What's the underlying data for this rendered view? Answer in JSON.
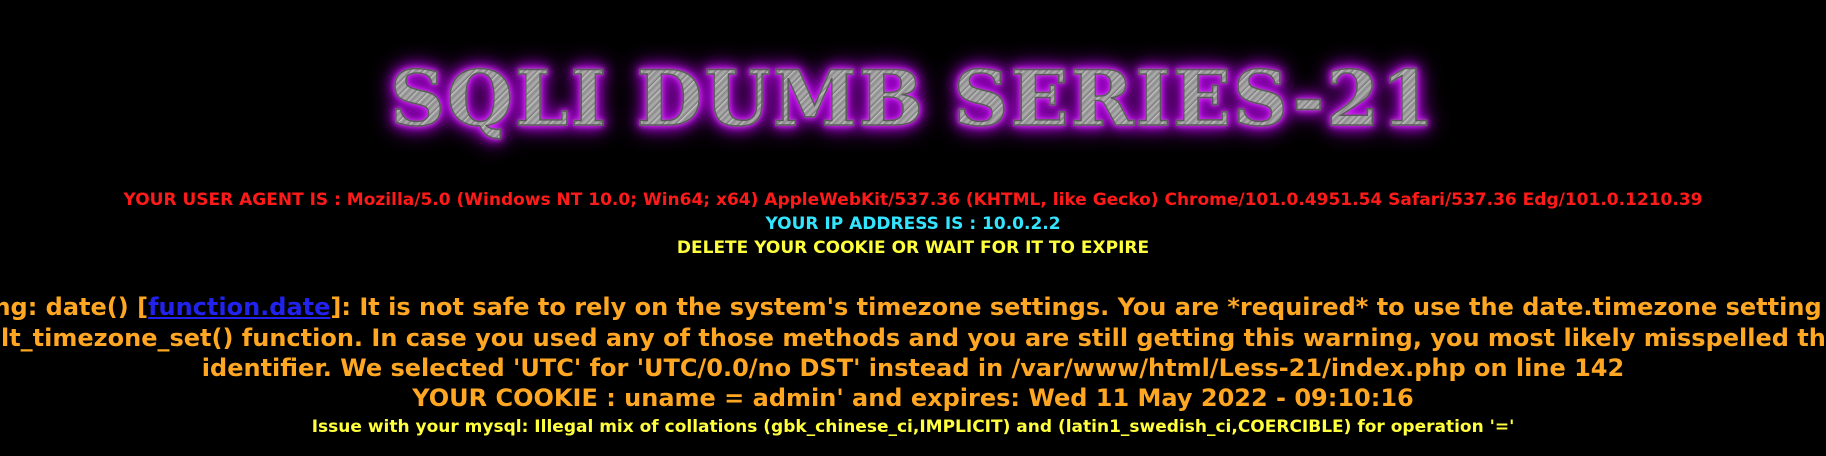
{
  "banner": {
    "title": "SQLI DUMB SERIES-21"
  },
  "info": {
    "user_agent": "YOUR USER AGENT IS : Mozilla/5.0 (Windows NT 10.0; Win64; x64) AppleWebKit/537.36 (KHTML, like Gecko) Chrome/101.0.4951.54 Safari/537.36 Edg/101.0.1210.39",
    "ip_address": "YOUR IP ADDRESS IS : 10.0.2.2",
    "cookie_notice": "DELETE YOUR COOKIE OR WAIT FOR IT TO EXPIRE"
  },
  "warning": {
    "prefix": "Warning: date() [",
    "link_text": "function.date",
    "line1_rest": "]: It is not safe to rely on the system's timezone settings. You are *required* to use the date.timezone setting or the",
    "line2": "date_default_timezone_set() function. In case you used any of those methods and you are still getting this warning, you most likely misspelled the timezone",
    "line3": "identifier. We selected 'UTC' for 'UTC/0.0/no DST' instead in /var/www/html/Less-21/index.php on line 142"
  },
  "cookie": {
    "text": "YOUR COOKIE : uname = admin' and expires: Wed 11 May 2022 - 09:10:16"
  },
  "mysql": {
    "error": "Issue with your mysql: Illegal mix of collations (gbk_chinese_ci,IMPLICIT) and (latin1_swedish_ci,COERCIBLE) for operation '='"
  },
  "colors": {
    "background": "#000000",
    "user_agent": "#ff1a1a",
    "ip": "#33e5ff",
    "notice": "#ffff3d",
    "warning": "#ffa722",
    "link": "#2222ee",
    "banner_glow": "#b000e0"
  }
}
